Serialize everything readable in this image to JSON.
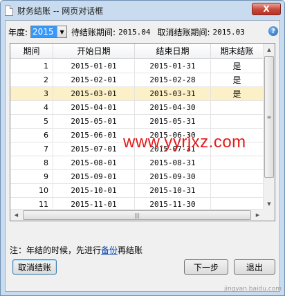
{
  "window": {
    "title": "财务结账 -- 网页对话框",
    "close_label": "X"
  },
  "toolbar": {
    "year_label": "年度:",
    "year_value": "2015",
    "pending_label": "待结账期间:",
    "pending_value": "2015.04",
    "cancel_label": "取消结账期间:",
    "cancel_value": "2015.03"
  },
  "table": {
    "columns": [
      "期间",
      "开始日期",
      "结束日期",
      "期末结账"
    ],
    "rows": [
      {
        "period": "1",
        "start": "2015-01-01",
        "end": "2015-01-31",
        "closed": "是"
      },
      {
        "period": "2",
        "start": "2015-02-01",
        "end": "2015-02-28",
        "closed": "是"
      },
      {
        "period": "3",
        "start": "2015-03-01",
        "end": "2015-03-31",
        "closed": "是"
      },
      {
        "period": "4",
        "start": "2015-04-01",
        "end": "2015-04-30",
        "closed": ""
      },
      {
        "period": "5",
        "start": "2015-05-01",
        "end": "2015-05-31",
        "closed": ""
      },
      {
        "period": "6",
        "start": "2015-06-01",
        "end": "2015-06-30",
        "closed": ""
      },
      {
        "period": "7",
        "start": "2015-07-01",
        "end": "2015-07-31",
        "closed": ""
      },
      {
        "period": "8",
        "start": "2015-08-01",
        "end": "2015-08-31",
        "closed": ""
      },
      {
        "period": "9",
        "start": "2015-09-01",
        "end": "2015-09-30",
        "closed": ""
      },
      {
        "period": "10",
        "start": "2015-10-01",
        "end": "2015-10-31",
        "closed": ""
      },
      {
        "period": "11",
        "start": "2015-11-01",
        "end": "2015-11-30",
        "closed": ""
      }
    ],
    "selected_period": "3"
  },
  "note": {
    "prefix": "注：年结的时候，先进行",
    "link": "备份",
    "suffix": "再结账"
  },
  "buttons": {
    "cancel_close": "取消结账",
    "next": "下一步",
    "exit": "退出"
  },
  "watermark": "www.yyrjxz.com",
  "footer_watermark": "jingyan.baidu.com",
  "colors": {
    "selected_row": "#fcf0c8",
    "watermark": "#e51a1a",
    "year_highlight": "#3399ff"
  },
  "icons": [
    "document-icon",
    "help-icon",
    "dropdown-arrow-icon"
  ]
}
